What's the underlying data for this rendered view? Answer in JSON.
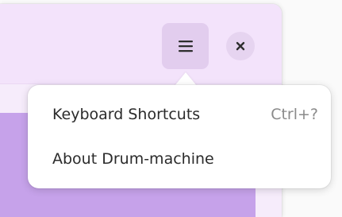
{
  "colors": {
    "headerbar": "#f3e3fb",
    "window_body": "#f6ecfb",
    "content_block": "#c6a2ea",
    "menu_button_bg": "#e2cdee",
    "close_button_bg": "#e6d4f0",
    "popover_bg": "#ffffff",
    "text_primary": "#2b2b2b",
    "text_secondary": "#8a8a8a"
  },
  "headerbar": {
    "menu_button_icon": "hamburger-menu-icon",
    "close_button_icon": "close-icon"
  },
  "menu": {
    "items": [
      {
        "label": "Keyboard Shortcuts",
        "accelerator": "Ctrl+?"
      },
      {
        "label": "About Drum-machine",
        "accelerator": ""
      }
    ]
  }
}
